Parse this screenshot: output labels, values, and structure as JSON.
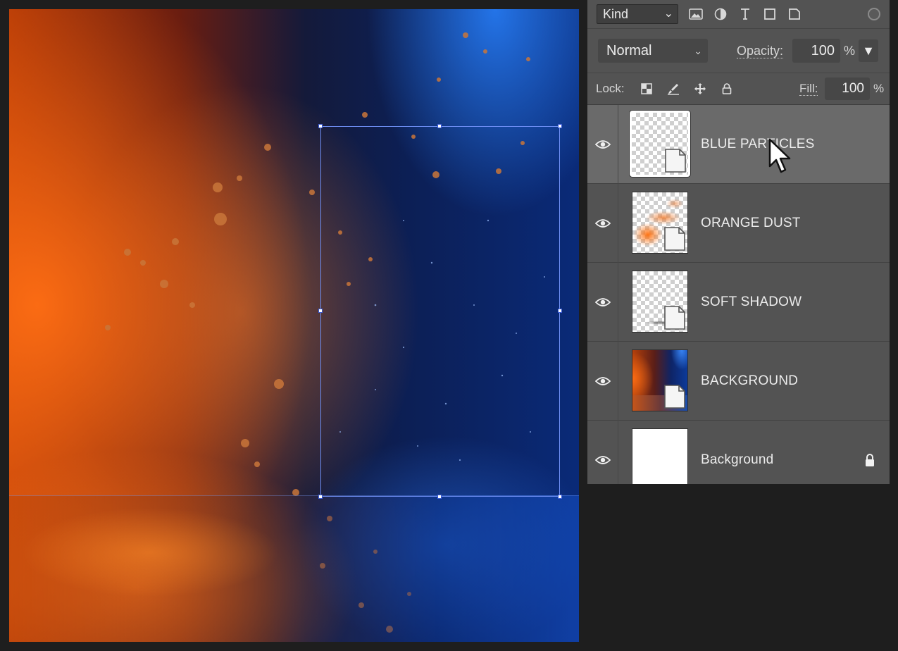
{
  "layers_panel": {
    "filter": {
      "kind_label": "Kind",
      "icons": [
        "image-filter-icon",
        "adjustment-filter-icon",
        "type-filter-icon",
        "shape-filter-icon",
        "smart-object-filter-icon"
      ]
    },
    "blend_mode": "Normal",
    "opacity_label": "Opacity:",
    "opacity_value": "100",
    "percent_sign": "%",
    "lock_label": "Lock:",
    "fill_label": "Fill:",
    "fill_value": "100",
    "layers": [
      {
        "name": "BLUE PARTICLES",
        "selected": true,
        "visible": true
      },
      {
        "name": "ORANGE DUST",
        "selected": false,
        "visible": true
      },
      {
        "name": "SOFT SHADOW",
        "selected": false,
        "visible": true
      },
      {
        "name": "BACKGROUND",
        "selected": false,
        "visible": true
      },
      {
        "name": "Background",
        "selected": false,
        "visible": true,
        "locked": true
      }
    ]
  },
  "colors": {
    "panel_bg": "#535353",
    "selected_row": "#6a6a6a",
    "transform_box": "#6f8ff5"
  }
}
